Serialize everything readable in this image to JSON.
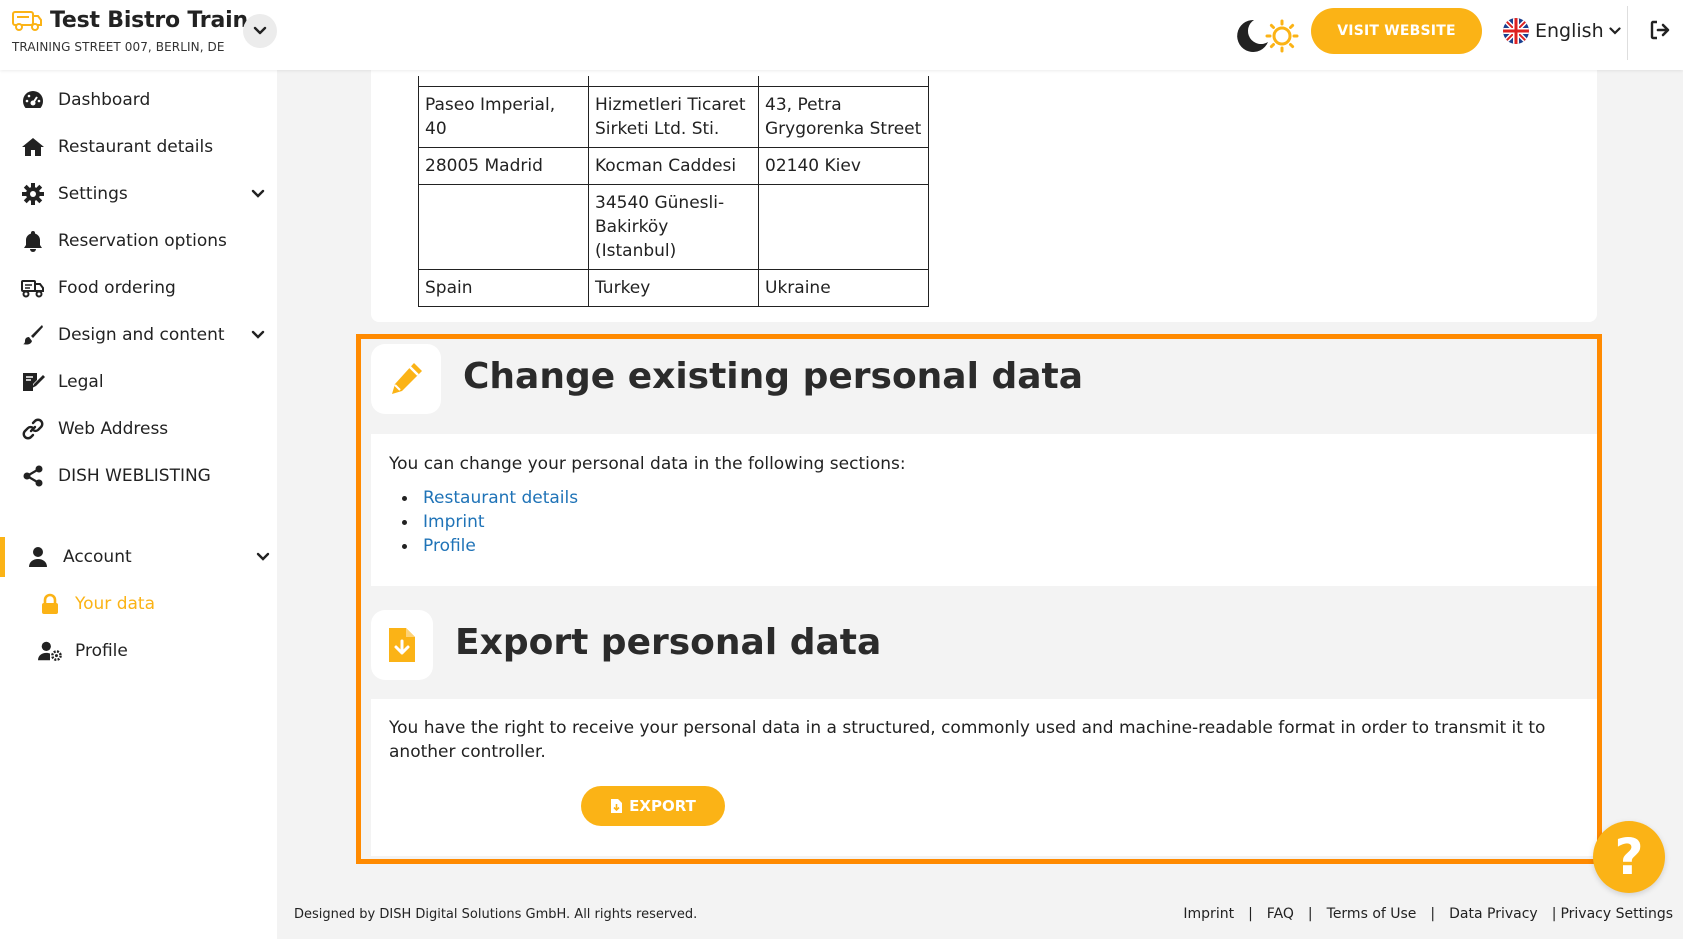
{
  "header": {
    "restaurant_name": "Test Bistro Train...",
    "address": "TRAINING STREET 007, BERLIN, DE",
    "visit_website_label": "VISIT WEBSITE",
    "language": "English",
    "accent_color": "#fbb316"
  },
  "sidebar": {
    "items": [
      {
        "label": "Dashboard",
        "icon": "dashboard-icon"
      },
      {
        "label": "Restaurant details",
        "icon": "home-icon"
      },
      {
        "label": "Settings",
        "icon": "gear-icon"
      },
      {
        "label": "Reservation options",
        "icon": "bell-icon"
      },
      {
        "label": "Food ordering",
        "icon": "food-ordering-icon"
      },
      {
        "label": "Design and content",
        "icon": "brush-icon"
      },
      {
        "label": "Legal",
        "icon": "legal-icon"
      },
      {
        "label": "Web Address",
        "icon": "link-icon"
      },
      {
        "label": "DISH WEBLISTING",
        "icon": "share-icon"
      },
      {
        "label": "Account",
        "icon": "user-icon"
      }
    ],
    "sub_items": [
      {
        "label": "Your data",
        "icon": "lock-icon"
      },
      {
        "label": "Profile",
        "icon": "user-gear-icon"
      }
    ]
  },
  "address_table": {
    "rows": [
      [
        "Paseo Imperial, 40",
        "Hizmetleri Ticaret Sirketi Ltd. Sti.",
        "43, Petra Grygorenka Street"
      ],
      [
        "28005 Madrid",
        "Kocman Caddesi",
        "02140 Kiev"
      ],
      [
        "",
        "34540 Günesli-Bakirköy (Istanbul)",
        ""
      ],
      [
        "Spain",
        "Turkey",
        "Ukraine"
      ]
    ]
  },
  "change_section": {
    "title": "Change existing personal data",
    "intro": "You can change your personal data in the following sections:",
    "links": [
      "Restaurant details",
      "Imprint",
      "Profile"
    ]
  },
  "export_section": {
    "title": "Export personal data",
    "text": "You have the right to receive your personal data in a structured, commonly used and machine-readable format in order to transmit it to another controller.",
    "button_label": "EXPORT"
  },
  "help": {
    "symbol": "?"
  },
  "footer": {
    "copyright": "Designed by DISH Digital Solutions GmbH. All rights reserved.",
    "links": [
      "Imprint",
      "FAQ",
      "Terms of Use",
      "Data Privacy",
      "Privacy Settings"
    ]
  }
}
